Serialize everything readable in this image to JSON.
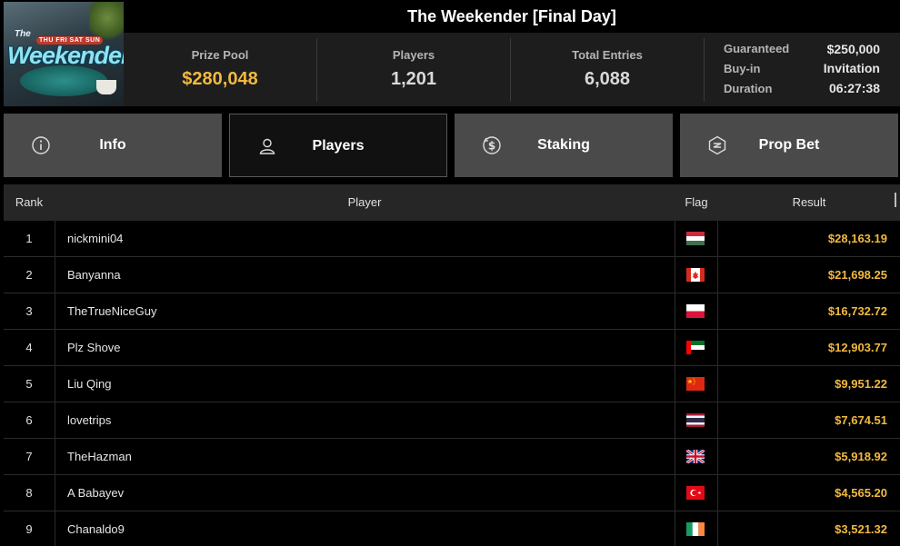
{
  "logo": {
    "top_text": "The",
    "days_text": "THU FRI SAT SUN",
    "word": "Weekender"
  },
  "title": "The Weekender [Final Day]",
  "stats": {
    "prize_pool_label": "Prize Pool",
    "prize_pool_value": "$280,048",
    "players_label": "Players",
    "players_value": "1,201",
    "entries_label": "Total Entries",
    "entries_value": "6,088",
    "guaranteed_label": "Guaranteed",
    "guaranteed_value": "$250,000",
    "buyin_label": "Buy-in",
    "buyin_value": "Invitation",
    "duration_label": "Duration",
    "duration_value": "06:27:38"
  },
  "tabs": [
    {
      "label": "Info",
      "icon": "info-icon"
    },
    {
      "label": "Players",
      "icon": "user-icon"
    },
    {
      "label": "Staking",
      "icon": "dollar-coin-icon"
    },
    {
      "label": "Prop Bet",
      "icon": "prop-bet-icon"
    }
  ],
  "active_tab": "Players",
  "table": {
    "headers": {
      "rank": "Rank",
      "player": "Player",
      "flag": "Flag",
      "result": "Result"
    },
    "rows": [
      {
        "rank": "1",
        "player": "nickmini04",
        "flag": "hungary-flag",
        "result": "$28,163.19"
      },
      {
        "rank": "2",
        "player": "Banyanna",
        "flag": "canada-flag",
        "result": "$21,698.25"
      },
      {
        "rank": "3",
        "player": "TheTrueNiceGuy",
        "flag": "poland-flag",
        "result": "$16,732.72"
      },
      {
        "rank": "4",
        "player": "Plz Shove",
        "flag": "uae-flag",
        "result": "$12,903.77"
      },
      {
        "rank": "5",
        "player": "Liu Qing",
        "flag": "china-flag",
        "result": "$9,951.22"
      },
      {
        "rank": "6",
        "player": "lovetrips",
        "flag": "thailand-flag",
        "result": "$7,674.51"
      },
      {
        "rank": "7",
        "player": "TheHazman",
        "flag": "uk-flag",
        "result": "$5,918.92"
      },
      {
        "rank": "8",
        "player": "A Babayev",
        "flag": "turkey-flag",
        "result": "$4,565.20"
      },
      {
        "rank": "9",
        "player": "Chanaldo9",
        "flag": "ireland-flag",
        "result": "$3,521.32"
      }
    ]
  },
  "colors": {
    "gold": "#f2b941",
    "tab_bg": "#4a4a4a",
    "panel_bg": "#1d1d1d"
  }
}
